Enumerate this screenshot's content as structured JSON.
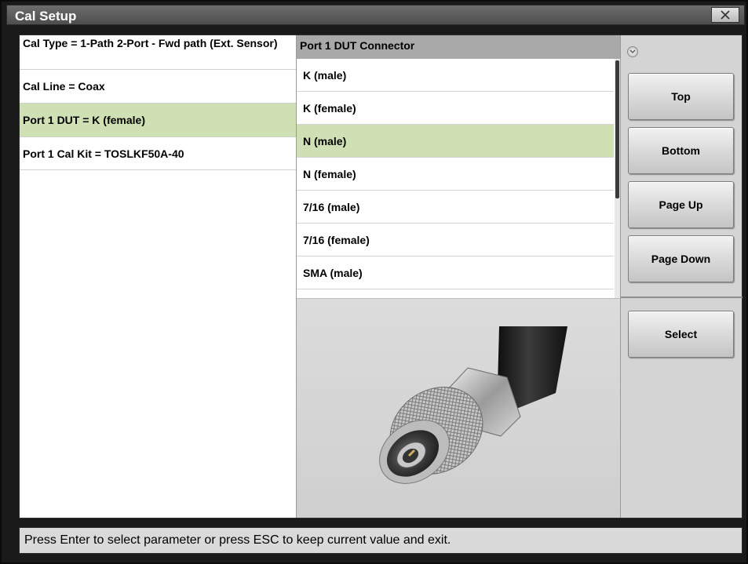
{
  "window": {
    "title": "Cal Setup"
  },
  "params": [
    {
      "label": "Cal Type = 1-Path 2-Port - Fwd path (Ext. Sensor)"
    },
    {
      "label": "Cal Line = Coax"
    },
    {
      "label": "Port 1 DUT = K (female)"
    },
    {
      "label": "Port 1 Cal Kit = TOSLKF50A-40"
    }
  ],
  "list": {
    "header": "Port 1 DUT Connector",
    "items": [
      "K (male)",
      "K (female)",
      "N (male)",
      "N (female)",
      "7/16 (male)",
      "7/16 (female)",
      "SMA (male)"
    ],
    "selected_index": 2
  },
  "buttons": {
    "top": "Top",
    "bottom": "Bottom",
    "page_up": "Page Up",
    "page_down": "Page Down",
    "select": "Select"
  },
  "status": {
    "text": "Press Enter to select parameter or press ESC to keep current value and exit."
  },
  "icons": {
    "close": "close-icon",
    "scroll_indicator": "chevron-down-icon",
    "preview": "n-male-connector-image"
  },
  "colors": {
    "selection": "#cfe0b4",
    "title_bar": "#5e5e5e",
    "list_header": "#a9a9a9"
  }
}
